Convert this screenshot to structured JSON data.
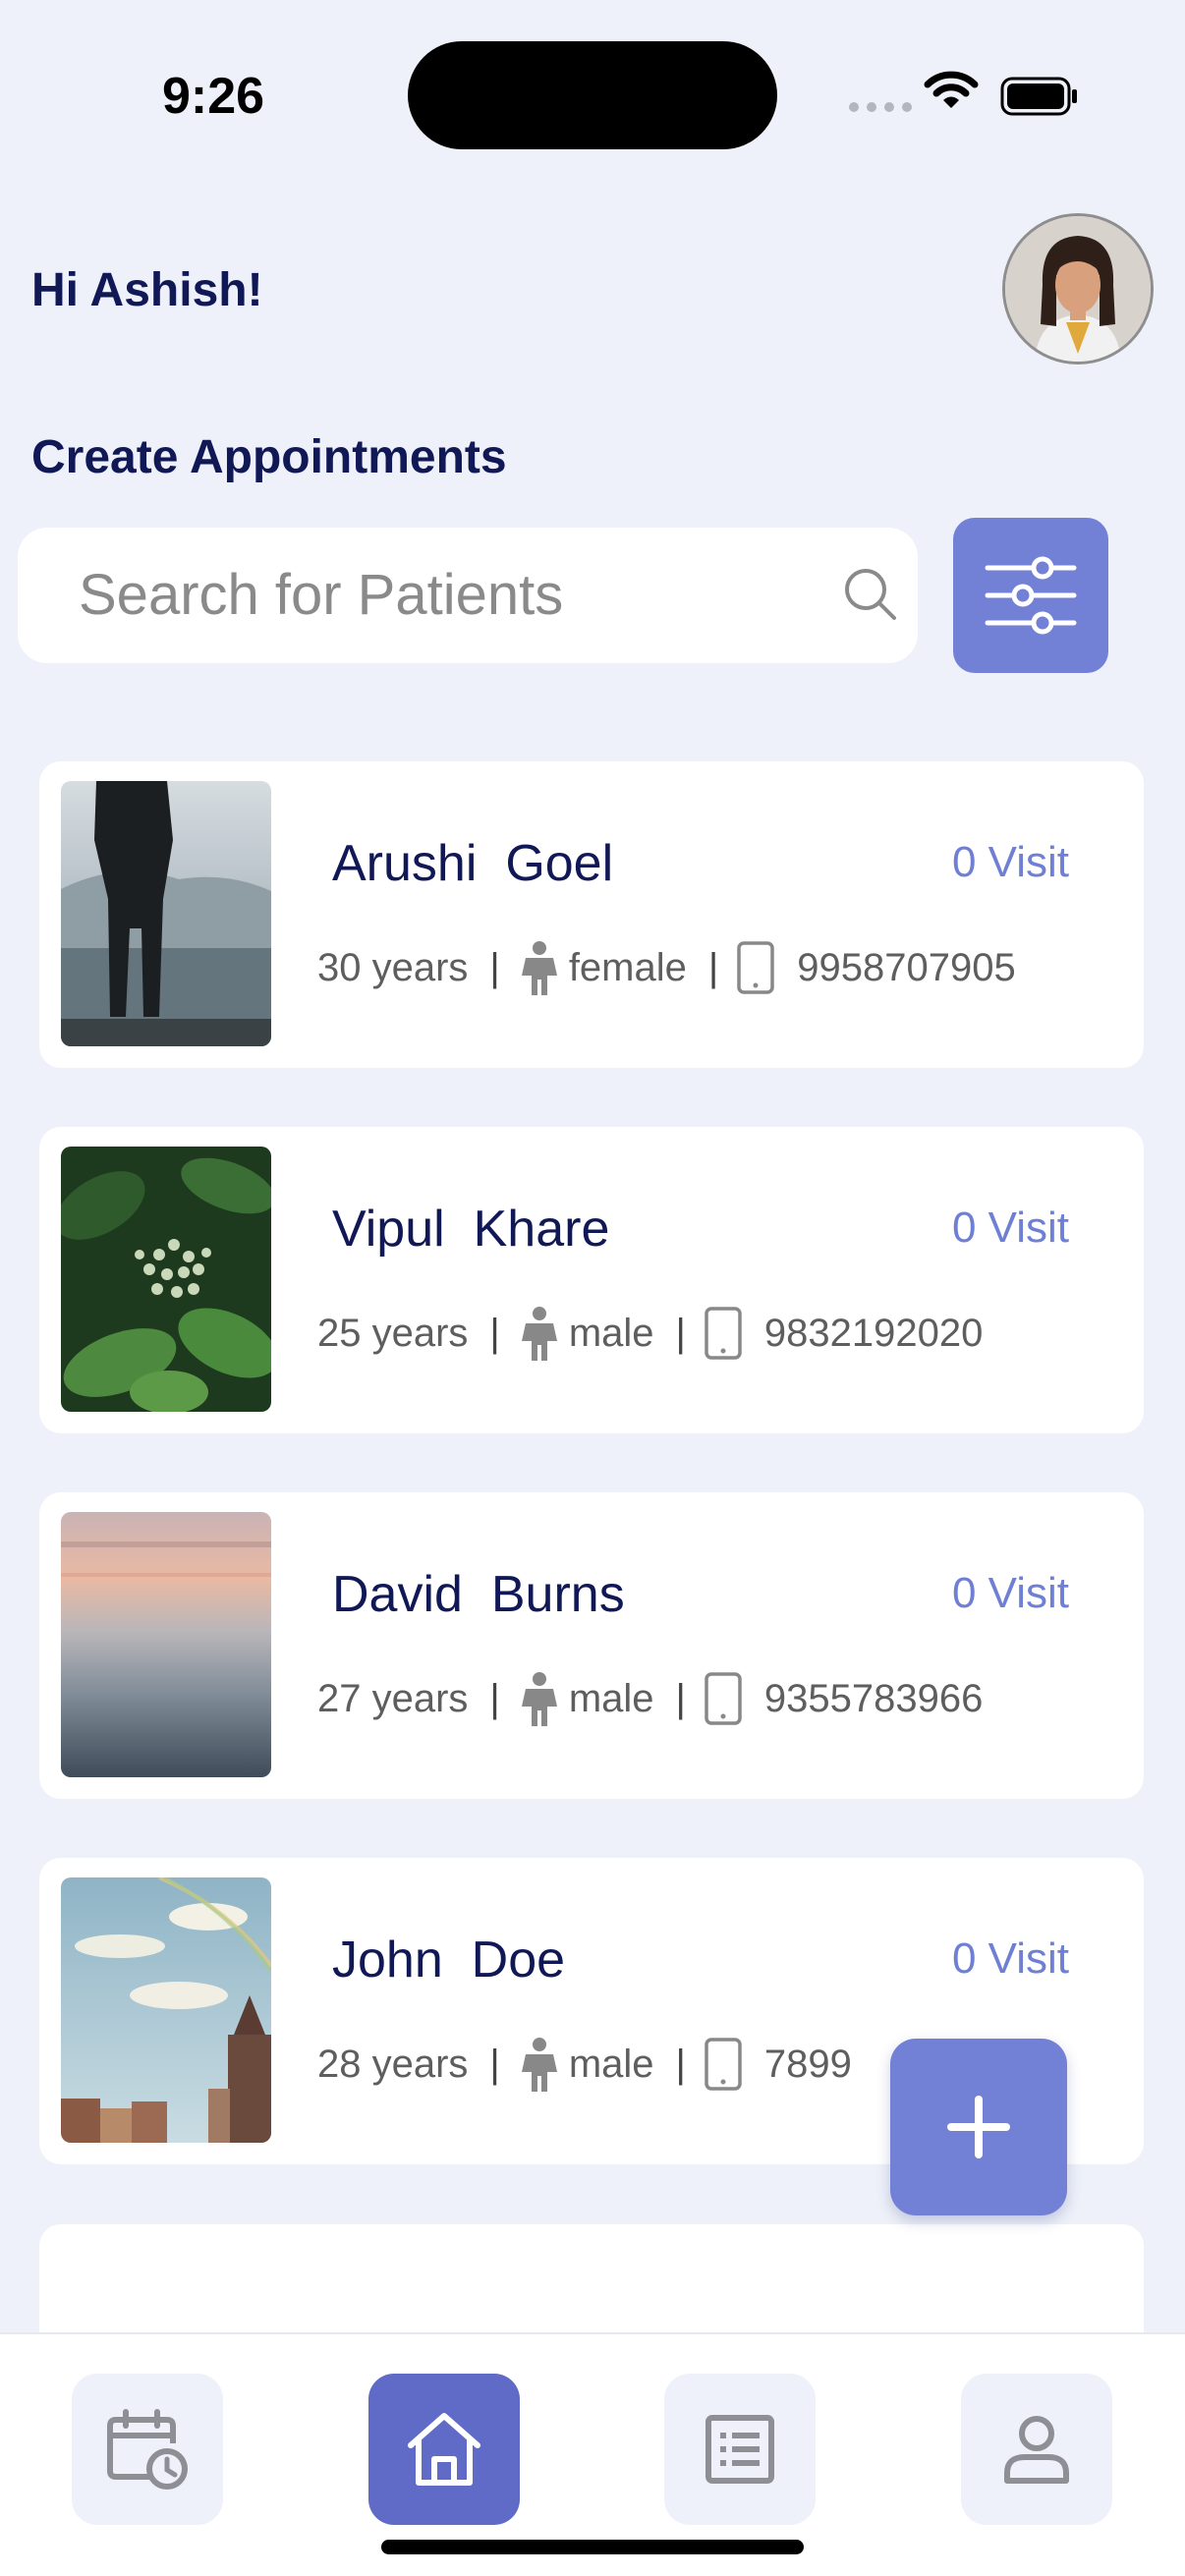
{
  "status_bar": {
    "time": "9:26"
  },
  "header": {
    "greeting": "Hi Ashish!"
  },
  "section": {
    "title": "Create Appointments"
  },
  "search": {
    "placeholder": "Search for Patients"
  },
  "patients": [
    {
      "first_name": "Arushi",
      "last_name": "Goel",
      "visits": "0 Visit",
      "age": "30 years",
      "gender": "female",
      "phone": "9958707905"
    },
    {
      "first_name": "Vipul",
      "last_name": "Khare",
      "visits": "0 Visit",
      "age": "25 years",
      "gender": "male",
      "phone": "9832192020"
    },
    {
      "first_name": "David",
      "last_name": "Burns",
      "visits": "0 Visit",
      "age": "27 years",
      "gender": "male",
      "phone": "9355783966"
    },
    {
      "first_name": "John",
      "last_name": "Doe",
      "visits": "0 Visit",
      "age": "28 years",
      "gender": "male",
      "phone": "7899"
    }
  ],
  "separator": "|",
  "fab": {
    "label": "+"
  },
  "bottom_nav": {
    "items": [
      {
        "icon": "calendar-clock-icon",
        "active": false
      },
      {
        "icon": "home-icon",
        "active": true
      },
      {
        "icon": "list-icon",
        "active": false
      },
      {
        "icon": "profile-icon",
        "active": false
      }
    ]
  },
  "colors": {
    "background": "#EEF1F9",
    "accent": "#7281D6",
    "active_nav": "#5F6BC7",
    "heading": "#111856",
    "visit_text": "#6F7FD3"
  }
}
